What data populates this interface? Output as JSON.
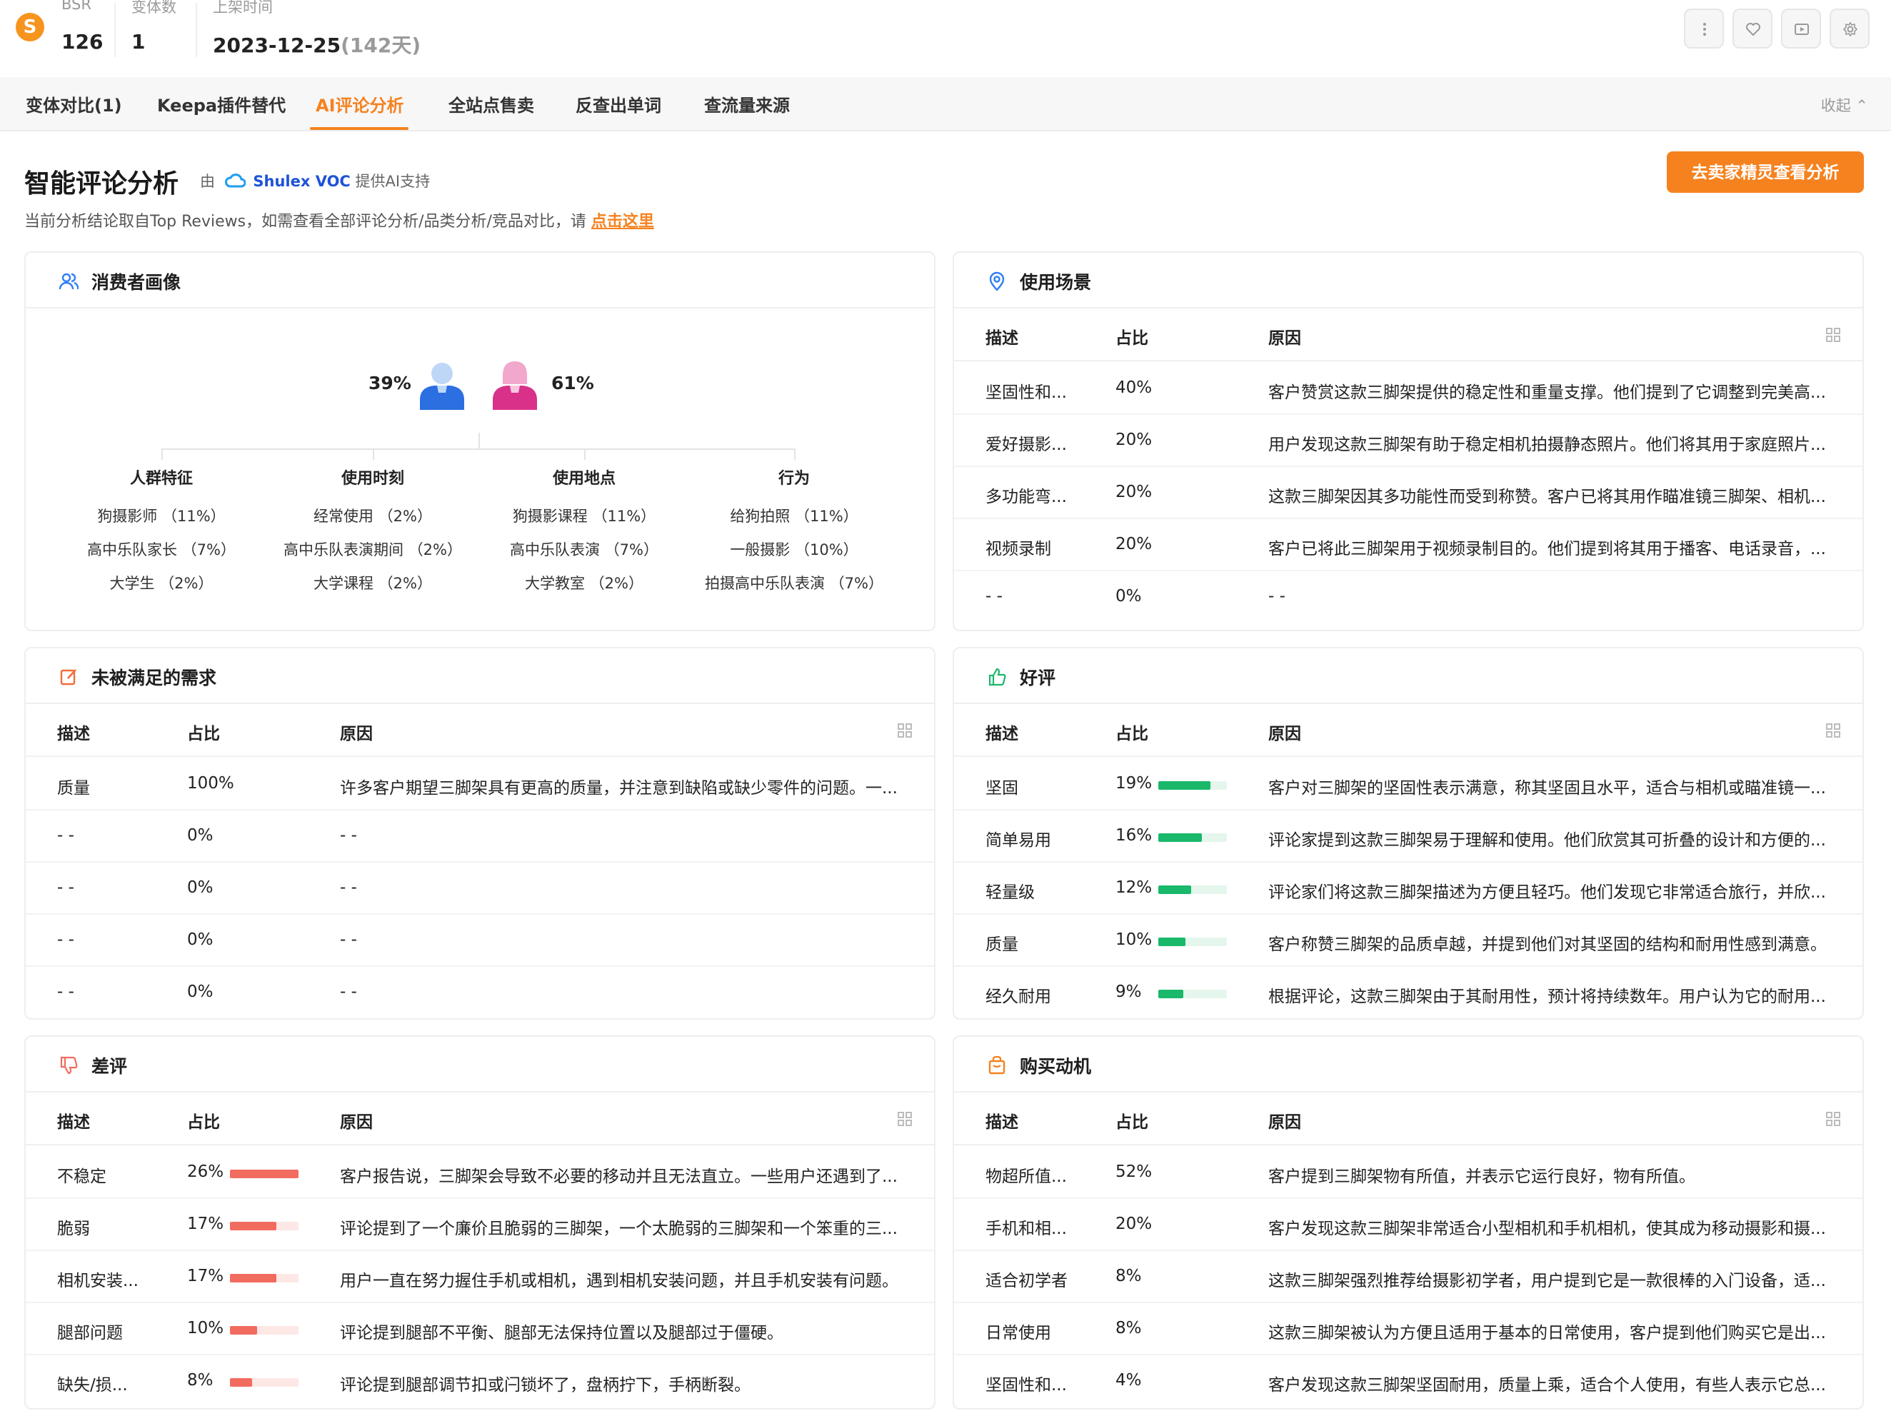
{
  "header": {
    "logo_letter": "S",
    "stats": [
      {
        "label": "BSR",
        "value": "126"
      },
      {
        "label": "变体数",
        "value": "1"
      },
      {
        "label": "上架时间",
        "value": "2023-12-25",
        "extra": "(142天)"
      }
    ]
  },
  "tabs": {
    "items": [
      "变体对比(1)",
      "Keepa插件替代",
      "AI评论分析",
      "全站点售卖",
      "反查出单词",
      "查流量来源"
    ],
    "active": "AI评论分析",
    "collapse_label": "收起"
  },
  "section": {
    "title": "智能评论分析",
    "provided_prefix": "由",
    "provider": "Shulex VOC",
    "provided_suffix": "提供AI支持",
    "note": "当前分析结论取自Top Reviews，如需查看全部评论分析/品类分析/竞品对比，请",
    "note_link": "点击这里",
    "cta_label": "去卖家精灵查看分析"
  },
  "persona": {
    "title": "消费者画像",
    "male_pct": "39%",
    "female_pct": "61%",
    "columns": [
      {
        "title": "人群特征",
        "items": [
          "狗摄影师 （11%）",
          "高中乐队家长 （7%）",
          "大学生 （2%）"
        ]
      },
      {
        "title": "使用时刻",
        "items": [
          "经常使用 （2%）",
          "高中乐队表演期间 （2%）",
          "大学课程 （2%）"
        ]
      },
      {
        "title": "使用地点",
        "items": [
          "狗摄影课程 （11%）",
          "高中乐队表演 （7%）",
          "大学教室 （2%）"
        ]
      },
      {
        "title": "行为",
        "items": [
          "给狗拍照 （11%）",
          "一般摄影 （10%）",
          "拍摄高中乐队表演 （7%）"
        ]
      }
    ]
  },
  "table_headers": {
    "desc": "描述",
    "ratio": "占比",
    "reason": "原因"
  },
  "scenarios": {
    "title": "使用场景",
    "rows": [
      {
        "desc": "坚固性和...",
        "ratio": "40%",
        "reason": "客户赞赏这款三脚架提供的稳定性和重量支撑。他们提到了它调整到完美高..."
      },
      {
        "desc": "爱好摄影...",
        "ratio": "20%",
        "reason": "用户发现这款三脚架有助于稳定相机拍摄静态照片。他们将其用于家庭照片..."
      },
      {
        "desc": "多功能弯...",
        "ratio": "20%",
        "reason": "这款三脚架因其多功能性而受到称赞。客户已将其用作瞄准镜三脚架、相机..."
      },
      {
        "desc": "视频录制",
        "ratio": "20%",
        "reason": "客户已将此三脚架用于视频录制目的。他们提到将其用于播客、电话录音，..."
      },
      {
        "desc": "- -",
        "ratio": "0%",
        "reason": "- -"
      }
    ]
  },
  "unmet": {
    "title": "未被满足的需求",
    "rows": [
      {
        "desc": "质量",
        "ratio": "100%",
        "reason": "许多客户期望三脚架具有更高的质量，并注意到缺陷或缺少零件的问题。一..."
      },
      {
        "desc": "- -",
        "ratio": "0%",
        "reason": "- -"
      },
      {
        "desc": "- -",
        "ratio": "0%",
        "reason": "- -"
      },
      {
        "desc": "- -",
        "ratio": "0%",
        "reason": "- -"
      },
      {
        "desc": "- -",
        "ratio": "0%",
        "reason": "- -"
      }
    ]
  },
  "positive": {
    "title": "好评",
    "rows": [
      {
        "desc": "坚固",
        "ratio": "19%",
        "level": 0.19,
        "reason": "客户对三脚架的坚固性表示满意，称其坚固且水平，适合与相机或瞄准镜一..."
      },
      {
        "desc": "简单易用",
        "ratio": "16%",
        "level": 0.16,
        "reason": "评论家提到这款三脚架易于理解和使用。他们欣赏其可折叠的设计和方便的..."
      },
      {
        "desc": "轻量级",
        "ratio": "12%",
        "level": 0.12,
        "reason": "评论家们将这款三脚架描述为方便且轻巧。他们发现它非常适合旅行，并欣..."
      },
      {
        "desc": "质量",
        "ratio": "10%",
        "level": 0.1,
        "reason": "客户称赞三脚架的品质卓越，并提到他们对其坚固的结构和耐用性感到满意。"
      },
      {
        "desc": "经久耐用",
        "ratio": "9%",
        "level": 0.09,
        "reason": "根据评论，这款三脚架由于其耐用性，预计将持续数年。用户认为它的耐用..."
      }
    ]
  },
  "negative": {
    "title": "差评",
    "rows": [
      {
        "desc": "不稳定",
        "ratio": "26%",
        "level": 0.26,
        "reason": "客户报告说，三脚架会导致不必要的移动并且无法直立。一些用户还遇到了..."
      },
      {
        "desc": "脆弱",
        "ratio": "17%",
        "level": 0.17,
        "reason": "评论提到了一个廉价且脆弱的三脚架，一个太脆弱的三脚架和一个笨重的三..."
      },
      {
        "desc": "相机安装...",
        "ratio": "17%",
        "level": 0.17,
        "reason": "用户一直在努力握住手机或相机，遇到相机安装问题，并且手机安装有问题。"
      },
      {
        "desc": "腿部问题",
        "ratio": "10%",
        "level": 0.1,
        "reason": "评论提到腿部不平衡、腿部无法保持位置以及腿部过于僵硬。"
      },
      {
        "desc": "缺失/损...",
        "ratio": "8%",
        "level": 0.08,
        "reason": "评论提到腿部调节扣或闩锁坏了，盘柄拧下，手柄断裂。"
      }
    ]
  },
  "motivation": {
    "title": "购买动机",
    "rows": [
      {
        "desc": "物超所值...",
        "ratio": "52%",
        "reason": "客户提到三脚架物有所值，并表示它运行良好，物有所值。"
      },
      {
        "desc": "手机和相...",
        "ratio": "20%",
        "reason": "客户发现这款三脚架非常适合小型相机和手机相机，使其成为移动摄影和摄..."
      },
      {
        "desc": "适合初学者",
        "ratio": "8%",
        "reason": "这款三脚架强烈推荐给摄影初学者，用户提到它是一款很棒的入门设备，适..."
      },
      {
        "desc": "日常使用",
        "ratio": "8%",
        "reason": "这款三脚架被认为方便且适用于基本的日常使用，客户提到他们购买它是出..."
      },
      {
        "desc": "坚固性和...",
        "ratio": "4%",
        "reason": "客户发现这款三脚架坚固耐用，质量上乘，适合个人使用，有些人表示它总..."
      }
    ]
  },
  "colors": {
    "accent": "#f5821f",
    "good": "#19b86a",
    "bad": "#f26b5f",
    "link": "#1e53d6"
  }
}
